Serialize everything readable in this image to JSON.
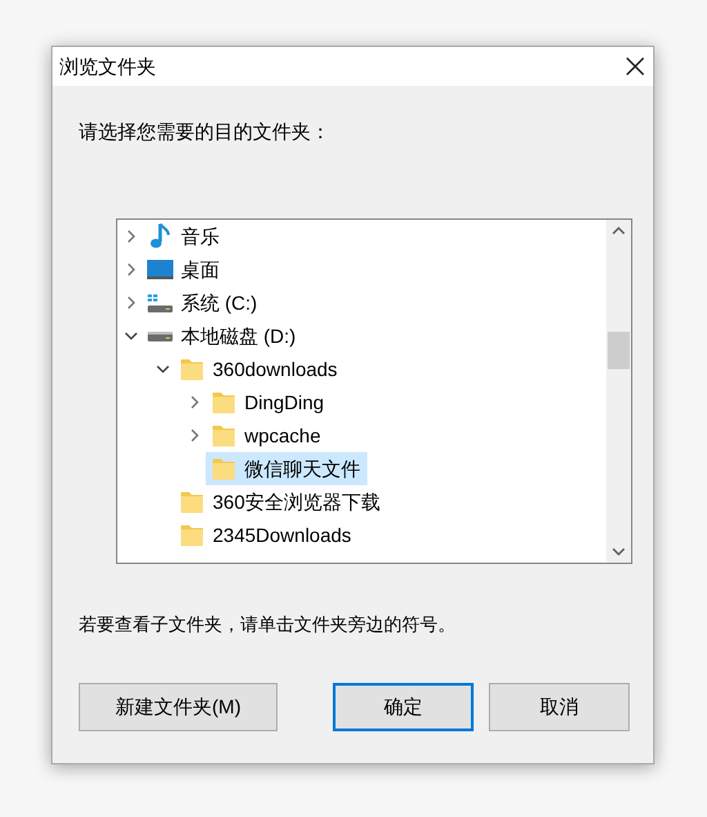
{
  "window": {
    "title": "浏览文件夹"
  },
  "prompt": "请选择您需要的目的文件夹：",
  "tree": [
    {
      "label": "音乐",
      "kind": "music",
      "expanded": false,
      "selected": false
    },
    {
      "label": "桌面",
      "kind": "desktop",
      "expanded": false,
      "selected": false
    },
    {
      "label": "系统 (C:)",
      "kind": "system-drive",
      "expanded": false,
      "selected": false
    },
    {
      "label": "本地磁盘 (D:)",
      "kind": "drive",
      "expanded": true,
      "selected": false,
      "children": [
        {
          "label": "360downloads",
          "kind": "folder",
          "expanded": true,
          "selected": false,
          "children": [
            {
              "label": "DingDing",
              "kind": "folder",
              "expanded": false,
              "selected": false
            },
            {
              "label": "wpcache",
              "kind": "folder",
              "expanded": false,
              "selected": false
            },
            {
              "label": "微信聊天文件",
              "kind": "folder",
              "selected": true
            }
          ]
        },
        {
          "label": "360安全浏览器下载",
          "kind": "folder",
          "selected": false
        },
        {
          "label": "2345Downloads",
          "kind": "folder",
          "selected": false
        }
      ]
    }
  ],
  "hint": "若要查看子文件夹，请单击文件夹旁边的符号。",
  "buttons": [
    {
      "label": "新建文件夹(M)",
      "default": false
    },
    {
      "label": "确定",
      "default": true
    },
    {
      "label": "取消",
      "default": false
    }
  ]
}
